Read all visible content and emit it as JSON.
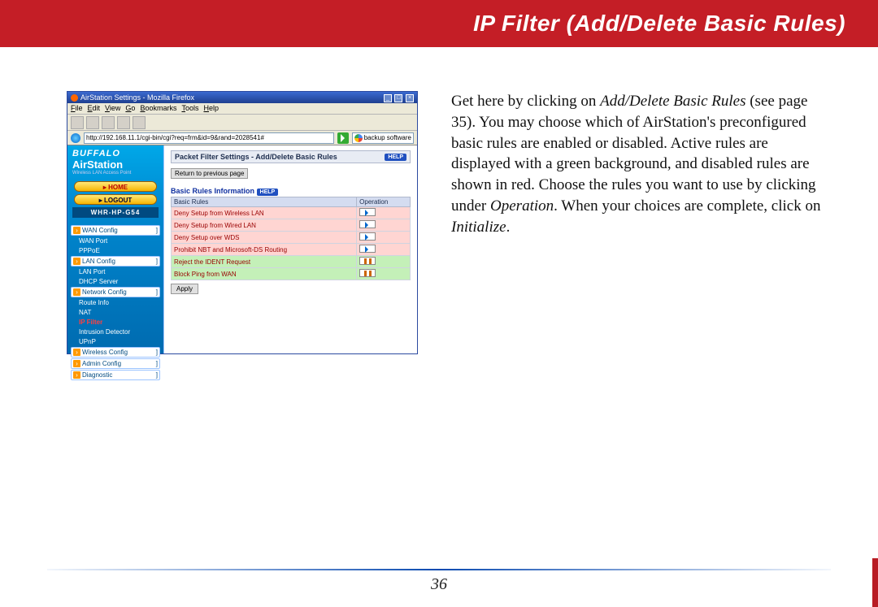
{
  "header": {
    "title": "IP Filter (Add/Delete Basic Rules)"
  },
  "browser": {
    "window_title": "AirStation Settings - Mozilla Firefox",
    "menus": {
      "file": "File",
      "edit": "Edit",
      "view": "View",
      "go": "Go",
      "bookmarks": "Bookmarks",
      "tools": "Tools",
      "help": "Help"
    },
    "url": "http://192.168.11.1/cgi-bin/cgi?req=frm&id=9&rand=2028541#",
    "search_placeholder": "backup software"
  },
  "sidebar": {
    "brand1": "BUFFALO",
    "brand2": "AirStation",
    "brand_sub": "Wireless LAN Access Point",
    "home": "HOME",
    "logout": "LOGOUT",
    "model": "WHR-HP-G54",
    "items": [
      {
        "label": "WAN Config",
        "type": "main"
      },
      {
        "label": "WAN Port",
        "type": "sub"
      },
      {
        "label": "PPPoE",
        "type": "sub"
      },
      {
        "label": "LAN Config",
        "type": "main"
      },
      {
        "label": "LAN Port",
        "type": "sub"
      },
      {
        "label": "DHCP Server",
        "type": "sub"
      },
      {
        "label": "Network Config",
        "type": "main"
      },
      {
        "label": "Route Info",
        "type": "sub"
      },
      {
        "label": "NAT",
        "type": "sub"
      },
      {
        "label": "IP Filter",
        "type": "sub",
        "active": true
      },
      {
        "label": "Intrusion Detector",
        "type": "sub"
      },
      {
        "label": "UPnP",
        "type": "sub"
      },
      {
        "label": "Wireless Config",
        "type": "main"
      },
      {
        "label": "Admin Config",
        "type": "main"
      },
      {
        "label": "Diagnostic",
        "type": "main"
      }
    ]
  },
  "panel": {
    "title": "Packet Filter Settings - Add/Delete Basic Rules",
    "help": "HELP",
    "return_btn": "Return to previous page",
    "section": "Basic Rules Information",
    "col_rules": "Basic Rules",
    "col_op": "Operation",
    "rows": [
      {
        "label": "Deny Setup from Wireless LAN",
        "state": "red",
        "op": "play"
      },
      {
        "label": "Deny Setup from Wired LAN",
        "state": "red",
        "op": "play"
      },
      {
        "label": "Deny Setup over WDS",
        "state": "red",
        "op": "play"
      },
      {
        "label": "Prohibit NBT and Microsoft-DS Routing",
        "state": "red",
        "op": "play"
      },
      {
        "label": "Reject the IDENT Request",
        "state": "green",
        "op": "pause"
      },
      {
        "label": "Block Ping from WAN",
        "state": "green",
        "op": "pause"
      }
    ],
    "apply": "Apply"
  },
  "copy": {
    "p1a": "Get here by clicking on ",
    "p1b": "Add/Delete Basic Rules",
    "p1c": " (see page 35).  You may choose which of AirStation's preconfigured basic rules are enabled or disabled.  Active rules are displayed with a green background, and disabled rules are shown in red.  Choose the rules you want to use by clicking under ",
    "p1d": "Operation",
    "p1e": ".  When your choices are complete, click on ",
    "p1f": "Initialize",
    "p1g": "."
  },
  "page_number": "36"
}
